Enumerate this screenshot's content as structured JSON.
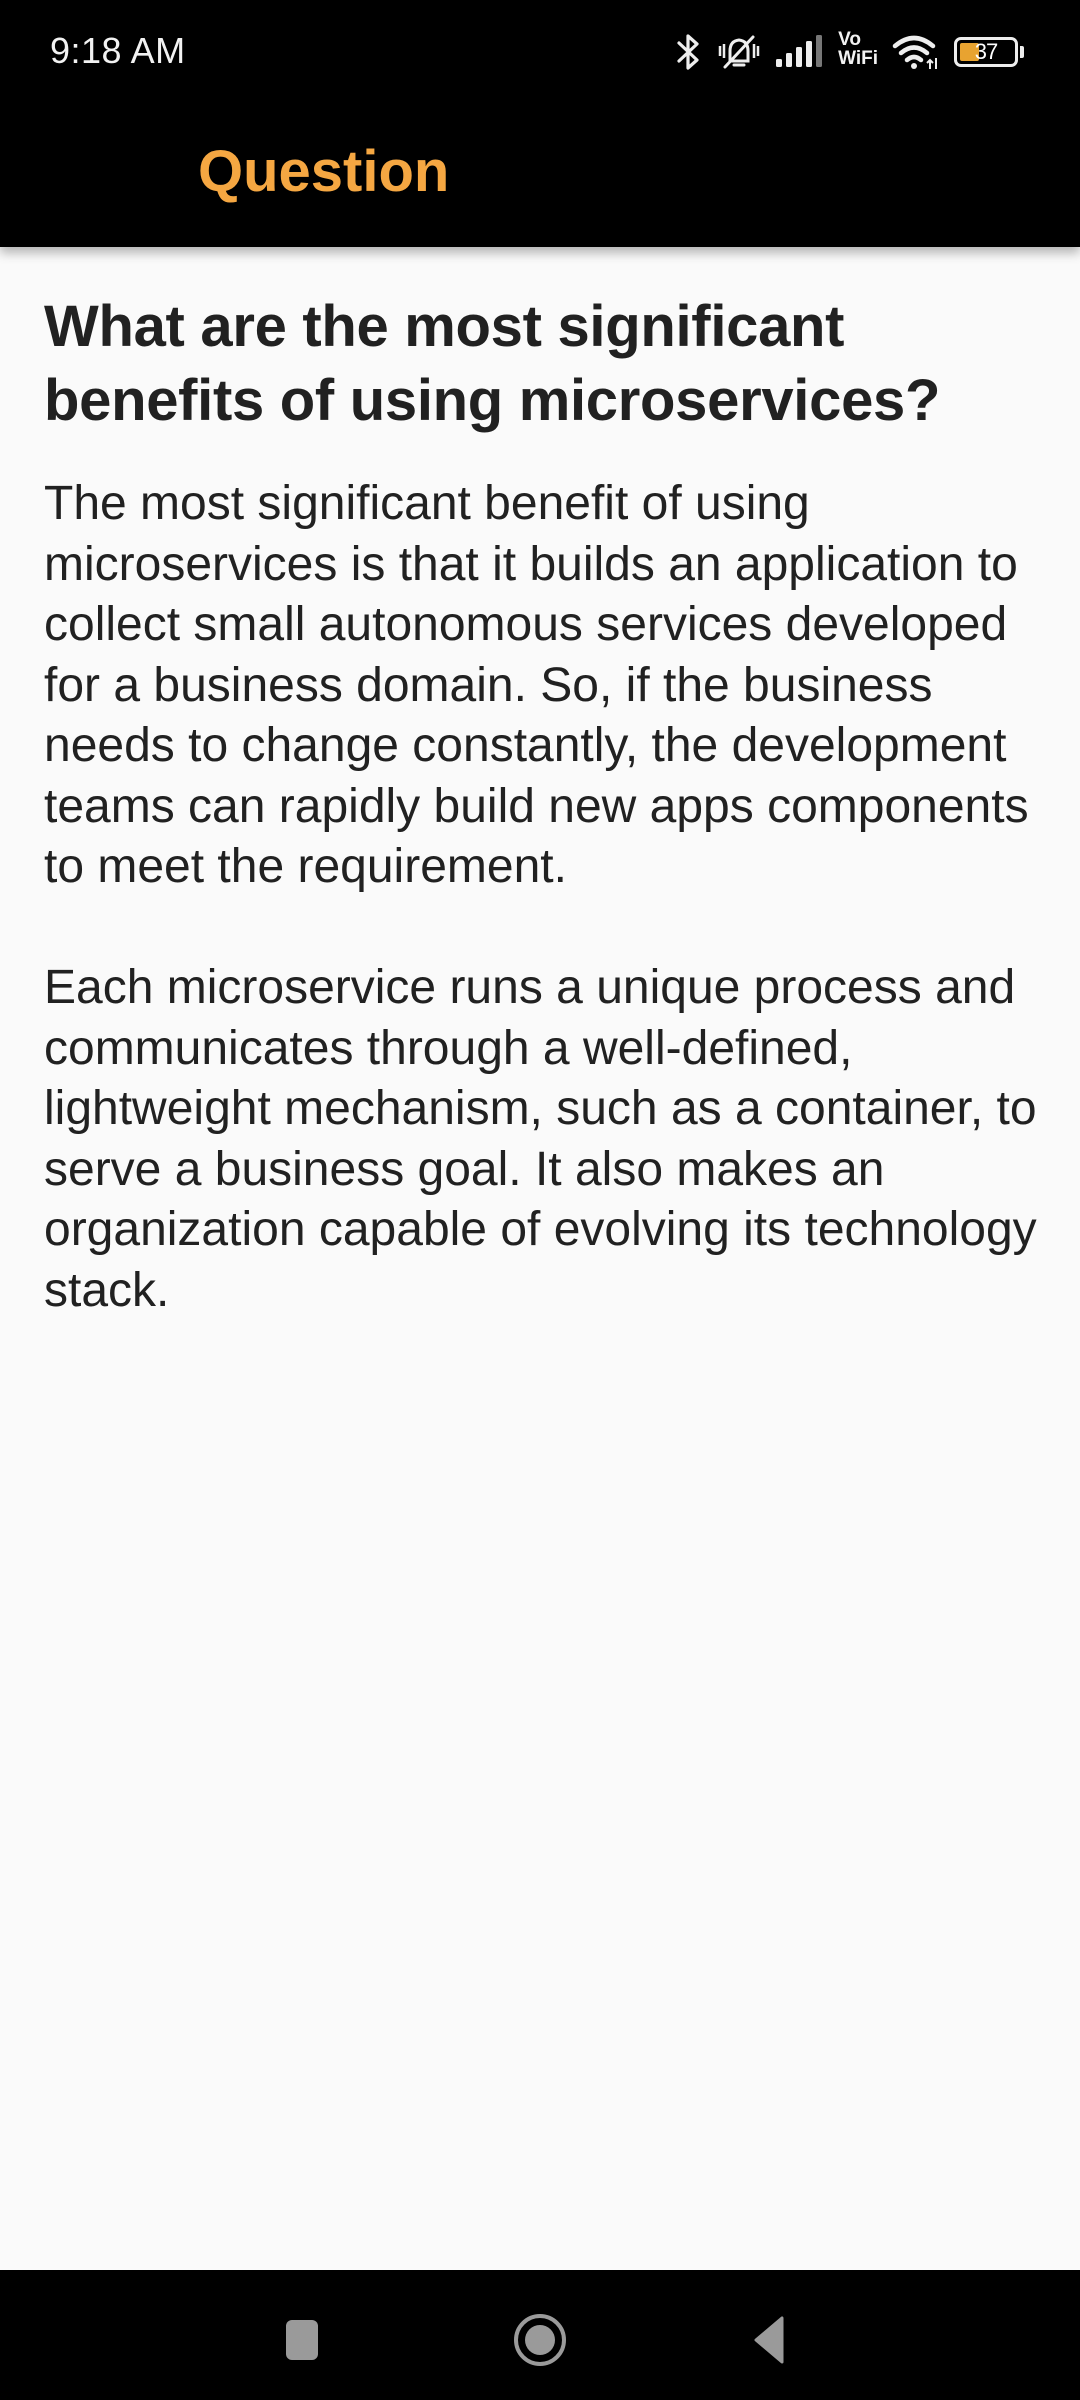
{
  "status_bar": {
    "time": "9:18 AM",
    "icons": [
      "bluetooth-icon",
      "vibrate-silent-icon",
      "signal-icon",
      "vowifi-icon",
      "wifi-icon",
      "battery-icon"
    ],
    "vowifi_top": "Vo",
    "vowifi_bottom": "WiFi",
    "battery_level": "37",
    "battery_fraction": 0.37,
    "battery_color": "#e8a330"
  },
  "app_bar": {
    "title": "Question",
    "title_color": "#f5a742"
  },
  "content": {
    "question": "What are the most significant benefits of using microservices?",
    "answer": "The most significant benefit of using microservices is that it builds an application to collect small autonomous services developed for a business domain. So, if the business needs to change constantly, the development teams can rapidly build new apps components to meet the requirement.\n\nEach microservice runs a unique process and communicates through a well-defined, lightweight mechanism, such as a container, to serve a business goal. It also makes an organization capable of evolving its technology stack."
  },
  "nav_bar": {
    "buttons": [
      "recents",
      "home",
      "back"
    ]
  }
}
